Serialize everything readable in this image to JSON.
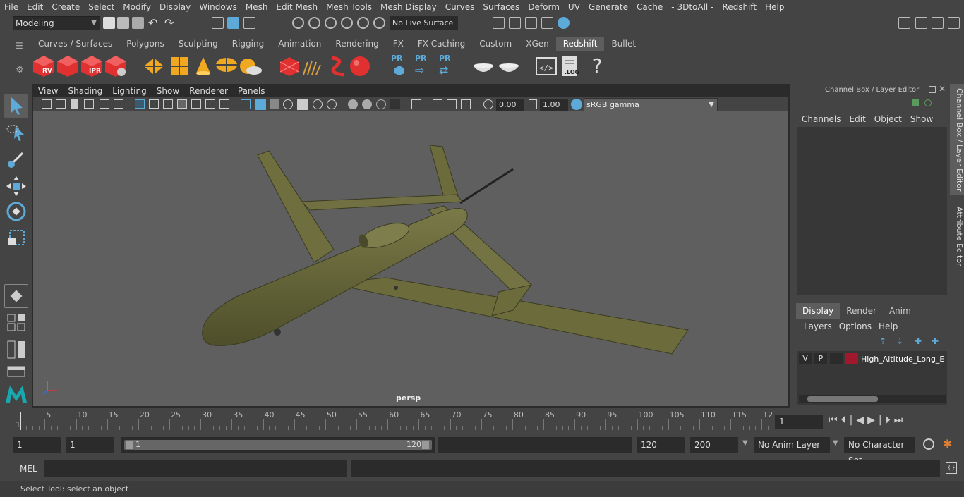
{
  "menubar": {
    "items": [
      "File",
      "Edit",
      "Create",
      "Select",
      "Modify",
      "Display",
      "Windows",
      "Mesh",
      "Edit Mesh",
      "Mesh Tools",
      "Mesh Display",
      "Curves",
      "Surfaces",
      "Deform",
      "UV",
      "Generate",
      "Cache",
      "- 3DtoAll -",
      "Redshift",
      "Help"
    ]
  },
  "statusline": {
    "mode": "Modeling",
    "live_surface": "No Live Surface"
  },
  "shelf": {
    "tabs": [
      "Curves / Surfaces",
      "Polygons",
      "Sculpting",
      "Rigging",
      "Animation",
      "Rendering",
      "FX",
      "FX Caching",
      "Custom",
      "XGen",
      "Redshift",
      "Bullet"
    ],
    "active_tab": "Redshift",
    "icon_labels": {
      "rv": "RV",
      "ipr": "IPR",
      "pr": "PR",
      "log": ".LOG",
      "help": "?"
    }
  },
  "viewport": {
    "menu": [
      "View",
      "Shading",
      "Lighting",
      "Show",
      "Renderer",
      "Panels"
    ],
    "exposure": "0.00",
    "gamma": "1.00",
    "color_space": "sRGB gamma",
    "camera_label": "persp"
  },
  "channel_box": {
    "title": "Channel Box / Layer Editor",
    "menu": [
      "Channels",
      "Edit",
      "Object",
      "Show"
    ]
  },
  "layer_editor": {
    "tabs": [
      "Display",
      "Render",
      "Anim"
    ],
    "active_tab": "Display",
    "menu": [
      "Layers",
      "Options",
      "Help"
    ],
    "layer": {
      "v": "V",
      "p": "P",
      "name": "High_Altitude_Long_E",
      "color": "#a0182c"
    }
  },
  "side_tabs": [
    "Channel Box / Layer Editor",
    "Attribute Editor"
  ],
  "timeline": {
    "ticks": [
      "5",
      "10",
      "15",
      "20",
      "25",
      "30",
      "35",
      "40",
      "45",
      "50",
      "55",
      "60",
      "65",
      "70",
      "75",
      "80",
      "85",
      "90",
      "95",
      "100",
      "105",
      "110",
      "115",
      "12"
    ],
    "current_frame_marker": "1",
    "current_frame": "1"
  },
  "range": {
    "start": "1",
    "inner_start": "1",
    "slider_start": "1",
    "slider_end": "120",
    "end": "120",
    "anim_end": "200",
    "anim_layer": "No Anim Layer",
    "character_set": "No Character Set"
  },
  "cmdline": {
    "label": "MEL"
  },
  "helpline": {
    "text": "Select Tool: select an object"
  },
  "colors": {
    "redshift_red": "#e03030",
    "accent_blue": "#5da9d8",
    "aircraft_olive": "#6b6b3c"
  }
}
